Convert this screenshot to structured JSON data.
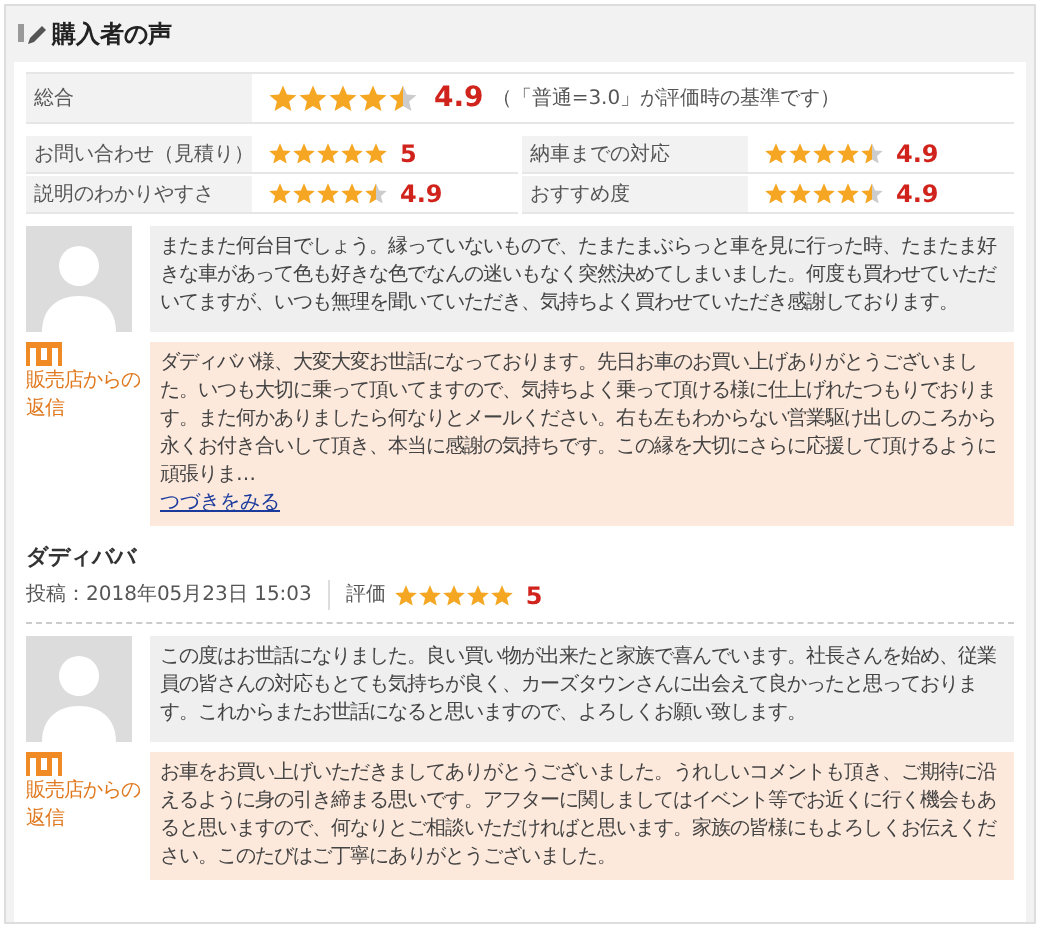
{
  "title": "購入者の声",
  "overall": {
    "label": "総合",
    "stars": 4.5,
    "score": "4.9",
    "note": "（「普通=3.0」が評価時の基準です）"
  },
  "ratings": [
    {
      "label": "お問い合わせ（見積り）",
      "stars": 5,
      "score": "5"
    },
    {
      "label": "納車までの対応",
      "stars": 4.5,
      "score": "4.9"
    },
    {
      "label": "説明のわかりやすさ",
      "stars": 4.5,
      "score": "4.9"
    },
    {
      "label": "おすすめ度",
      "stars": 4.5,
      "score": "4.9"
    }
  ],
  "reviews": [
    {
      "comment": "またまた何台目でしょう。縁っていないもので、たまたまぶらっと車を見に行った時、たまたま好きな車があって色も好きな色でなんの迷いもなく突然決めてしまいました。何度も買わせていただいてますが、いつも無理を聞いていただき、気持ちよく買わせていただき感謝しております。",
      "reply_label": "販売店からの返信",
      "reply": "ダディババ様、大変大変お世話になっております。先日お車のお買い上げありがとうございました。いつも大切に乗って頂いてますので、気持ちよく乗って頂ける様に仕上げれたつもりでおります。また何かありましたら何なりとメールください。右も左もわからない営業駆け出しのころから永くお付き合いして頂き、本当に感謝の気持ちです。この縁を大切にさらに応援して頂けるように頑張りま…",
      "more_link": "つづきをみる",
      "author": "ダディババ",
      "posted": "投稿：2018年05月23日 15:03",
      "rating_label": "評価",
      "stars": 5,
      "score": "5"
    },
    {
      "comment": "この度はお世話になりました。良い買い物が出来たと家族で喜んでいます。社長さんを始め、従業員の皆さんの対応もとても気持ちが良く、カーズタウンさんに出会えて良かったと思っております。これからまたお世話になると思いますので、よろしくお願い致します。",
      "reply_label": "販売店からの返信",
      "reply": "お車をお買い上げいただきましてありがとうございました。うれしいコメントも頂き、ご期待に沿えるように身の引き締まる思いです。アフターに関しましてはイベント等でお近くに行く機会もあると思いますので、何なりとご相談いただければと思います。家族の皆様にもよろしくお伝えください。このたびはご丁寧にありがとうございました。"
    }
  ]
}
